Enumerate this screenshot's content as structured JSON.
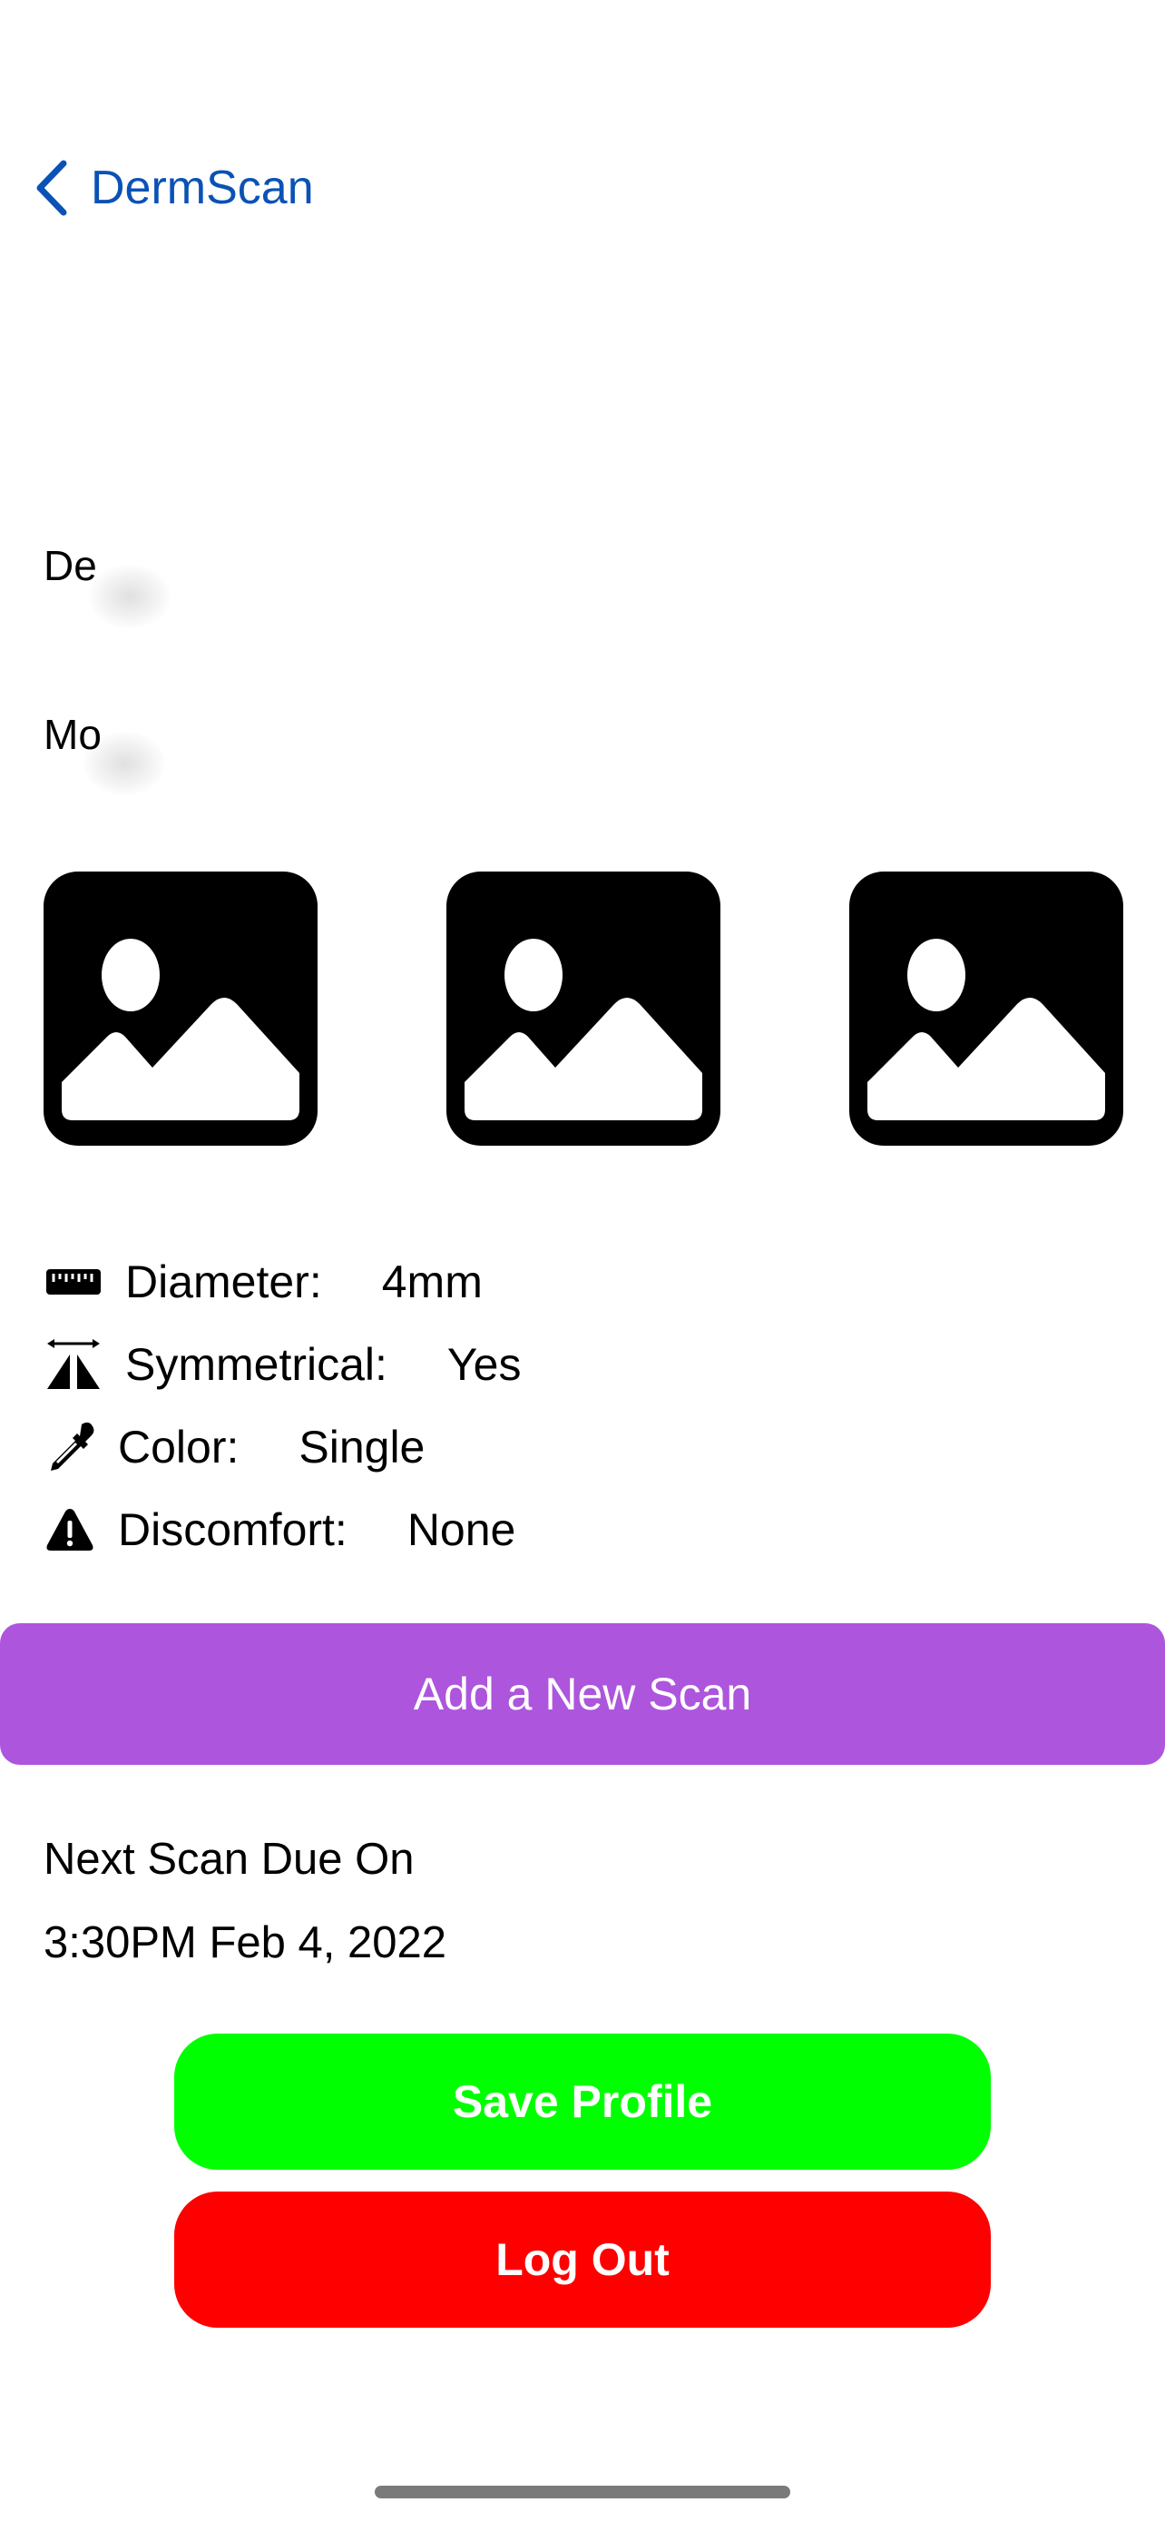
{
  "nav": {
    "back_label": "DermScan"
  },
  "fields": {
    "field1_label": "De",
    "field2_label": "Mo"
  },
  "photos": [
    "photo-placeholder-icon",
    "photo-placeholder-icon",
    "photo-placeholder-icon"
  ],
  "stats": {
    "diameter": {
      "label": "Diameter:",
      "value": "4mm",
      "icon": "ruler-icon"
    },
    "symmetrical": {
      "label": "Symmetrical:",
      "value": "Yes",
      "icon": "symmetry-icon"
    },
    "color": {
      "label": "Color:",
      "value": "Single",
      "icon": "eyedropper-icon"
    },
    "discomfort": {
      "label": "Discomfort:",
      "value": "None",
      "icon": "warning-icon"
    }
  },
  "add_scan_label": "Add a New Scan",
  "next_scan": {
    "label": "Next Scan Due On",
    "datetime": "3:30PM Feb 4, 2022"
  },
  "buttons": {
    "save_label": "Save Profile",
    "logout_label": "Log Out"
  },
  "colors": {
    "link": "#0a52b5",
    "add_scan_bg": "#ad55dd",
    "save_bg": "#00ff00",
    "logout_bg": "#ff0000"
  }
}
